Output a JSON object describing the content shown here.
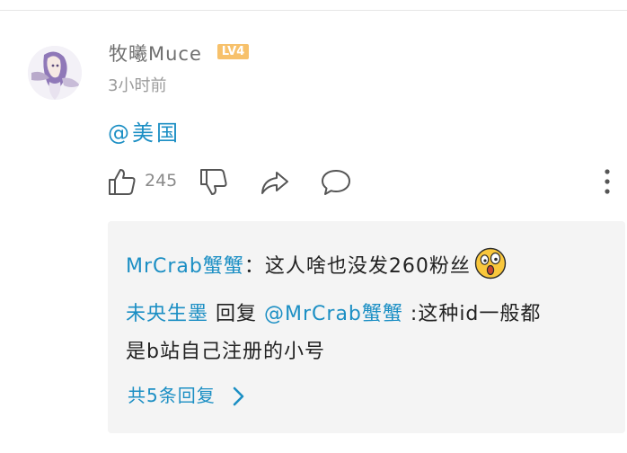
{
  "comment": {
    "username": "牧曦Muce",
    "level_badge": "LV4",
    "timestamp": "3小时前",
    "content": "@美国",
    "like_count": "245"
  },
  "icons": {
    "like": "thumbs-up-icon",
    "dislike": "thumbs-down-icon",
    "share": "share-icon",
    "reply": "comment-bubble-icon",
    "more": "more-vertical-icon",
    "emoji": "shocked-face-emoji-icon",
    "chevron": "chevron-right-icon"
  },
  "replies": [
    {
      "user": "MrCrab蟹蟹",
      "separator": "：",
      "text": "这人啥也没发260粉丝"
    },
    {
      "user": "未央生墨",
      "reply_word": " 回复 ",
      "target": "@MrCrab蟹蟹",
      "separator": " :",
      "text": "这种id一般都",
      "text_cont": "是b站自己注册的小号"
    }
  ],
  "view_all_label": "共5条回复",
  "colors": {
    "link_blue": "#1c8fc4",
    "badge_orange": "#f7c16b",
    "reply_bg": "#f4f4f4"
  }
}
